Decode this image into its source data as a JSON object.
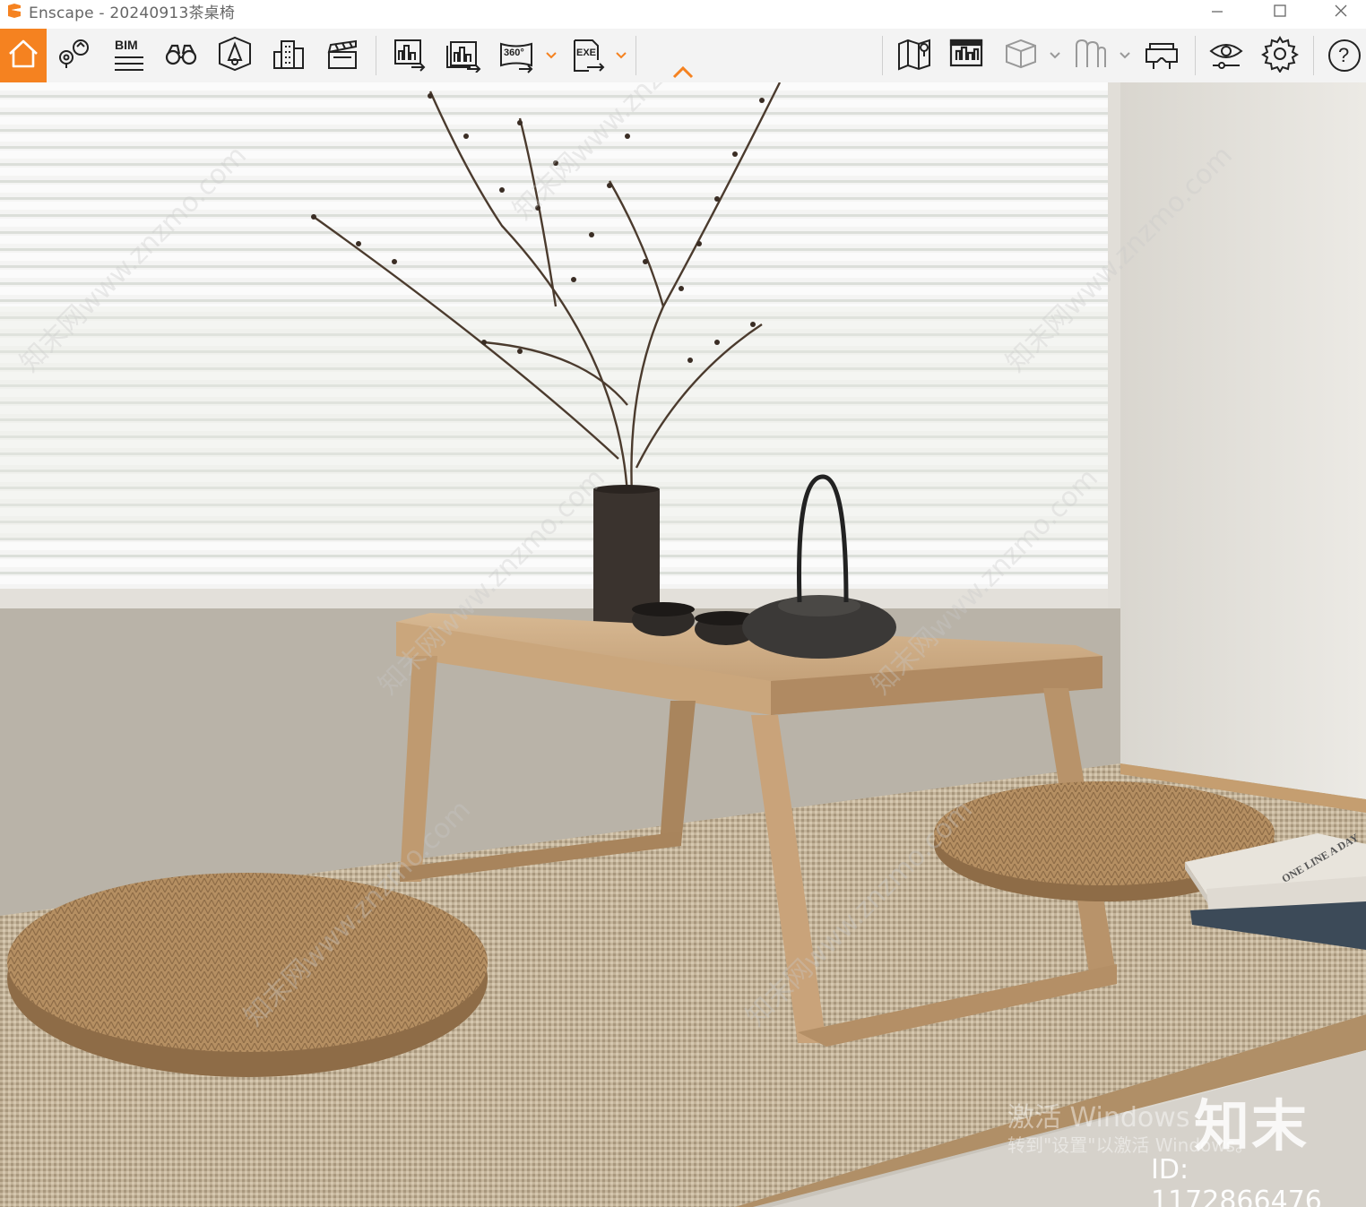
{
  "window": {
    "app_name": "Enscape",
    "title": "Enscape - 20240913茶桌椅",
    "accent_color": "#f58220"
  },
  "toolbar": {
    "left_buttons": [
      {
        "name": "home",
        "icon": "home-icon"
      },
      {
        "name": "views",
        "icon": "map-pin-views-icon"
      },
      {
        "name": "bim",
        "icon": "bim-icon",
        "label": "BIM"
      },
      {
        "name": "binoculars",
        "icon": "binoculars-icon"
      },
      {
        "name": "atmosphere",
        "icon": "atmosphere-icon"
      },
      {
        "name": "assets",
        "icon": "buildings-icon"
      },
      {
        "name": "video",
        "icon": "clapperboard-icon"
      }
    ],
    "export_buttons": [
      {
        "name": "render-image",
        "icon": "render-image-icon"
      },
      {
        "name": "batch-render",
        "icon": "batch-render-icon"
      },
      {
        "name": "panorama",
        "icon": "panorama-360-icon",
        "label": "360°"
      },
      {
        "name": "exe",
        "icon": "exe-export-icon",
        "label": "EXE"
      }
    ],
    "right_buttons": [
      {
        "name": "map",
        "icon": "map-icon"
      },
      {
        "name": "collaboration",
        "icon": "presentation-icon"
      },
      {
        "name": "cube",
        "icon": "cube-icon"
      },
      {
        "name": "material",
        "icon": "material-icon"
      },
      {
        "name": "vr",
        "icon": "vr-headset-icon"
      },
      {
        "name": "visual-settings",
        "icon": "eye-settings-icon"
      },
      {
        "name": "settings",
        "icon": "gear-icon"
      },
      {
        "name": "help",
        "icon": "help-icon",
        "label": "?"
      }
    ]
  },
  "viewport": {
    "watermark_text": "知末",
    "watermark_id": "ID: 1172866476",
    "diagonal_watermark": "知末网www.znzmo.com",
    "activation_line1": "激活 Windows",
    "activation_line2": "转到\"设置\"以激活 Windows。",
    "book_title": "ONE LINE A DAY"
  }
}
